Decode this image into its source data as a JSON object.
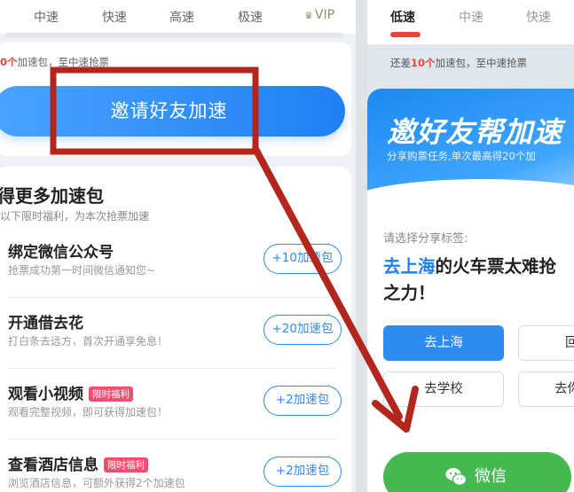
{
  "left": {
    "tabs": [
      "中速",
      "快速",
      "高速",
      "极速",
      "VIP"
    ],
    "hint": {
      "number": "0个",
      "text": "加速包，至中速抢票"
    },
    "invite_button": "邀请好友加速",
    "section_title": "得更多加速包",
    "section_sub": "以下限时福利，为本次抢票加速",
    "tasks": [
      {
        "title": "绑定微信公众号",
        "badge": "",
        "desc": "抢票成功第一时间微信通知您~",
        "button": "+10加速包"
      },
      {
        "title": "开通借去花",
        "badge": "",
        "desc": "打白条去远方，首次开通享免息！",
        "button": "+20加速包"
      },
      {
        "title": "观看小视频",
        "badge": "限时福利",
        "desc": "观看完整视频，即可获得加速包！",
        "button": "+2加速包"
      },
      {
        "title": "查看酒店信息",
        "badge": "限时福利",
        "desc": "浏览酒店信息，可额外获得2个加速包",
        "button": "+2加速包"
      }
    ]
  },
  "right": {
    "tabs": [
      "低速",
      "中速",
      "快速"
    ],
    "hint": {
      "prefix": "还差",
      "number": "10个",
      "suffix": "加速包，至中速抢票"
    },
    "banner_title": "邀好友帮加速",
    "banner_sub": "分享购票任务,单次最高得20个加",
    "label": "请选择分享标签:",
    "share_highlight": "去上海",
    "share_rest_line1": "的火车票太难抢",
    "share_line2": "之力！",
    "chips": [
      "去上海",
      "回",
      "去学校",
      "去你"
    ],
    "wechat_button": "微信"
  }
}
